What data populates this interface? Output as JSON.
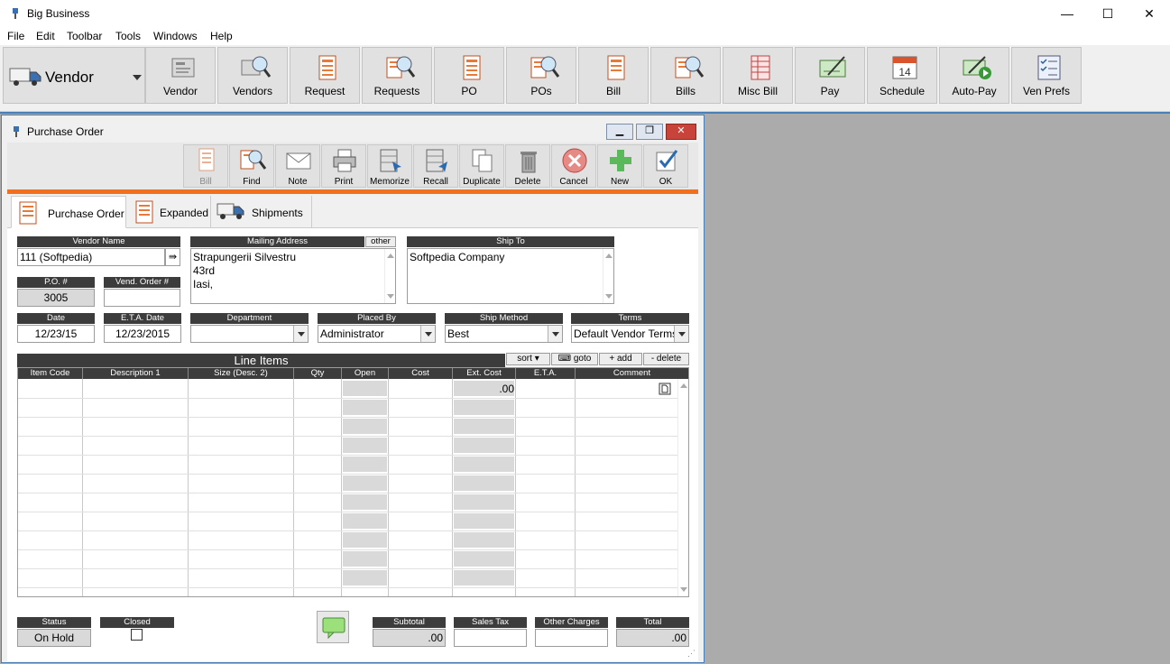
{
  "window": {
    "title": "Big Business",
    "minimize": "—",
    "maximize": "☐",
    "close": "✕"
  },
  "menu": [
    "File",
    "Edit",
    "Toolbar",
    "Tools",
    "Windows",
    "Help"
  ],
  "module_selector": {
    "label": "Vendor"
  },
  "toolbar": [
    {
      "label": "Vendor",
      "icon": "vendor-card-icon"
    },
    {
      "label": "Vendors",
      "icon": "vendors-search-icon"
    },
    {
      "label": "Request",
      "icon": "request-doc-icon"
    },
    {
      "label": "Requests",
      "icon": "requests-search-icon"
    },
    {
      "label": "PO",
      "icon": "po-doc-icon"
    },
    {
      "label": "POs",
      "icon": "pos-search-icon"
    },
    {
      "label": "Bill",
      "icon": "bill-doc-icon"
    },
    {
      "label": "Bills",
      "icon": "bills-search-icon"
    },
    {
      "label": "Misc Bill",
      "icon": "misc-bill-icon"
    },
    {
      "label": "Pay",
      "icon": "pay-check-icon"
    },
    {
      "label": "Schedule",
      "icon": "calendar-icon"
    },
    {
      "label": "Auto-Pay",
      "icon": "autopay-icon"
    },
    {
      "label": "Ven Prefs",
      "icon": "checklist-icon"
    }
  ],
  "po_window": {
    "title": "Purchase Order",
    "actions": [
      {
        "label": "Bill",
        "disabled": true
      },
      {
        "label": "Find"
      },
      {
        "label": "Note"
      },
      {
        "label": "Print"
      },
      {
        "label": "Memorize"
      },
      {
        "label": "Recall"
      },
      {
        "label": "Duplicate"
      },
      {
        "label": "Delete"
      },
      {
        "label": "Cancel"
      },
      {
        "label": "New"
      },
      {
        "label": "OK"
      }
    ],
    "tabs": [
      "Purchase Order",
      "Expanded",
      "Shipments"
    ],
    "fields": {
      "vendor_name": {
        "label": "Vendor Name",
        "value": "111 (Softpedia)"
      },
      "po_number": {
        "label": "P.O. #",
        "value": "3005"
      },
      "vend_order": {
        "label": "Vend. Order #",
        "value": ""
      },
      "mailing_address": {
        "label": "Mailing Address",
        "other": "other",
        "lines": [
          "Strapungerii Silvestru",
          "43rd",
          "Iasi,"
        ]
      },
      "ship_to": {
        "label": "Ship To",
        "value": "Softpedia Company"
      },
      "date": {
        "label": "Date",
        "value": "12/23/15"
      },
      "eta_date": {
        "label": "E.T.A. Date",
        "value": "12/23/2015"
      },
      "department": {
        "label": "Department",
        "value": ""
      },
      "placed_by": {
        "label": "Placed By",
        "value": "Administrator"
      },
      "ship_method": {
        "label": "Ship Method",
        "value": "Best"
      },
      "terms": {
        "label": "Terms",
        "value": "Default Vendor Terms"
      }
    },
    "line_items": {
      "title": "Line Items",
      "sort": "sort",
      "goto": "goto",
      "add": "+ add",
      "delete": "- delete",
      "columns": [
        "Item Code",
        "Description 1",
        "Size (Desc. 2)",
        "Qty",
        "Open",
        "Cost",
        "Ext. Cost",
        "E.T.A.",
        "Comment"
      ],
      "first_row_ext_cost": ".00"
    },
    "footer": {
      "status": {
        "label": "Status",
        "value": "On Hold"
      },
      "closed": {
        "label": "Closed",
        "checked": false
      },
      "subtotal": {
        "label": "Subtotal",
        "value": ".00"
      },
      "sales_tax": {
        "label": "Sales Tax",
        "value": ""
      },
      "other_charges": {
        "label": "Other Charges",
        "value": ""
      },
      "total": {
        "label": "Total",
        "value": ".00"
      }
    }
  }
}
